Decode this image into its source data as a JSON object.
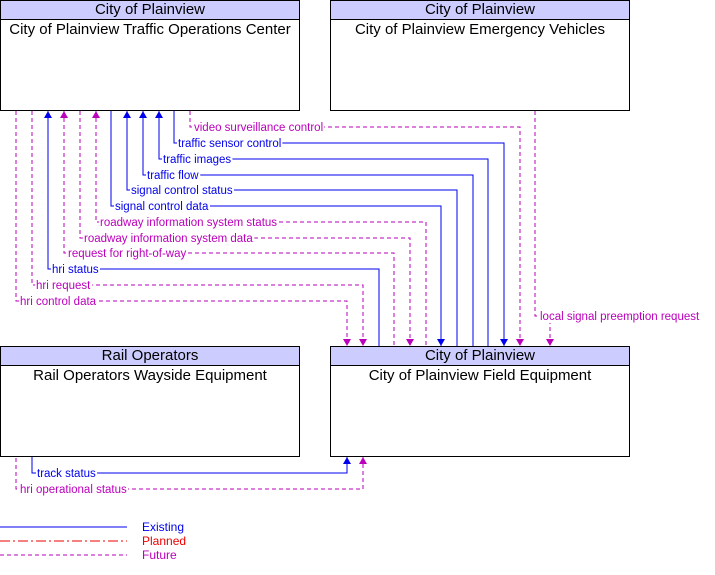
{
  "colors": {
    "existing": "#0000ee",
    "planned": "#ee0000",
    "future": "#bb00bb",
    "header_fill": "#ccccff"
  },
  "boxes": {
    "toc": {
      "header": "City of Plainview",
      "title": "City of Plainview Traffic Operations Center"
    },
    "ev": {
      "header": "City of Plainview",
      "title": "City of Plainview Emergency Vehicles"
    },
    "rail": {
      "header": "Rail Operators",
      "title": "Rail Operators Wayside Equipment"
    },
    "field": {
      "header": "City of Plainview",
      "title": "City of Plainview Field Equipment"
    }
  },
  "flows": [
    {
      "label": "video surveillance control",
      "status": "future",
      "from": "toc",
      "to": "field"
    },
    {
      "label": "traffic sensor control",
      "status": "existing",
      "from": "toc",
      "to": "field"
    },
    {
      "label": "traffic images",
      "status": "existing",
      "from": "field",
      "to": "toc"
    },
    {
      "label": "traffic flow",
      "status": "existing",
      "from": "field",
      "to": "toc"
    },
    {
      "label": "signal control status",
      "status": "existing",
      "from": "field",
      "to": "toc"
    },
    {
      "label": "signal control data",
      "status": "existing",
      "from": "toc",
      "to": "field"
    },
    {
      "label": "roadway information system status",
      "status": "future",
      "from": "field",
      "to": "toc"
    },
    {
      "label": "roadway information system data",
      "status": "future",
      "from": "toc",
      "to": "field"
    },
    {
      "label": "request for right-of-way",
      "status": "future",
      "from": "field",
      "to": "toc"
    },
    {
      "label": "hri status",
      "status": "existing",
      "from": "field",
      "to": "toc"
    },
    {
      "label": "hri request",
      "status": "future",
      "from": "toc",
      "to": "field"
    },
    {
      "label": "hri control data",
      "status": "future",
      "from": "toc",
      "to": "field"
    },
    {
      "label": "local signal preemption request",
      "status": "future",
      "from": "ev",
      "to": "field"
    },
    {
      "label": "track status",
      "status": "existing",
      "from": "rail",
      "to": "field"
    },
    {
      "label": "hri operational status",
      "status": "future",
      "from": "field",
      "to": "rail"
    }
  ],
  "legend": [
    {
      "label": "Existing",
      "status": "existing"
    },
    {
      "label": "Planned",
      "status": "planned"
    },
    {
      "label": "Future",
      "status": "future"
    }
  ]
}
